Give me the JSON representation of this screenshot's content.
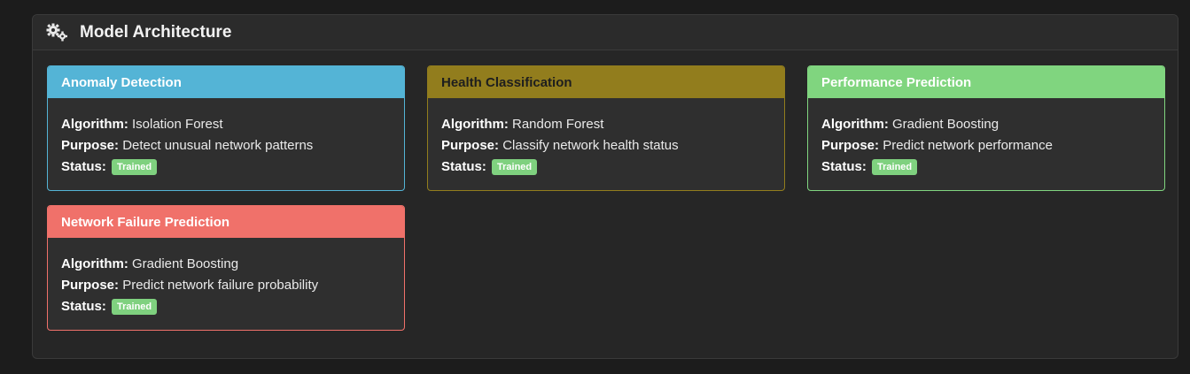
{
  "panel": {
    "title": "Model Architecture",
    "icon": "gears-icon"
  },
  "labels": {
    "algorithm": "Algorithm:",
    "purpose": "Purpose:",
    "status": "Status:"
  },
  "models": [
    {
      "name": "Anomaly Detection",
      "algorithm": "Isolation Forest",
      "purpose": "Detect unusual network patterns",
      "status": "Trained",
      "color": "#54b4d6"
    },
    {
      "name": "Health Classification",
      "algorithm": "Random Forest",
      "purpose": "Classify network health status",
      "status": "Trained",
      "color": "#927d1d"
    },
    {
      "name": "Performance Prediction",
      "algorithm": "Gradient Boosting",
      "purpose": "Predict network performance",
      "status": "Trained",
      "color": "#80d57f"
    },
    {
      "name": "Network Failure Prediction",
      "algorithm": "Gradient Boosting",
      "purpose": "Predict network failure probability",
      "status": "Trained",
      "color": "#f0716a"
    }
  ],
  "colors": {
    "status_badge": "#7fd17f"
  }
}
